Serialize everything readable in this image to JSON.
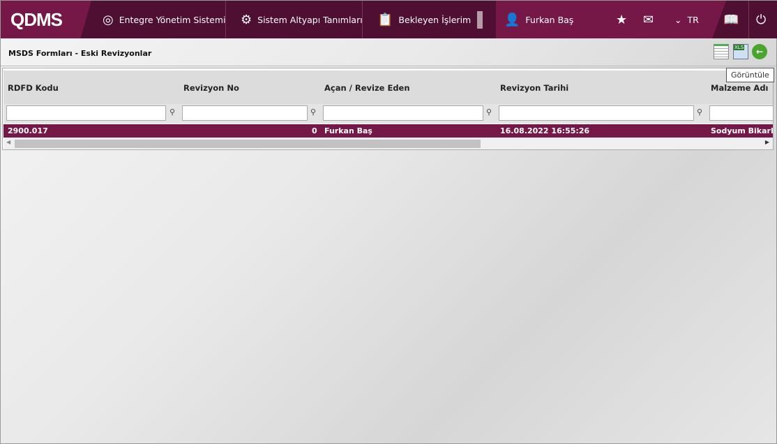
{
  "header": {
    "logo": "QDMS",
    "nav": [
      "Entegre Yönetim Sistemi",
      "Sistem Altyapı Tanımları",
      "Bekleyen İşlerim"
    ],
    "user": "Furkan Baş",
    "language": "TR"
  },
  "page": {
    "title": "MSDS Formları - Eski Revizyonlar",
    "tooltip": "Görüntüle"
  },
  "grid": {
    "columns": [
      "RDFD Kodu",
      "Revizyon No",
      "Açan / Revize Eden",
      "Revizyon Tarihi",
      "Malzeme Adı"
    ],
    "rows": [
      [
        "2900.017",
        "0",
        "Furkan Baş",
        "16.08.2022 16:55:26",
        "Sodyum Bikarbonat"
      ]
    ]
  },
  "colors": {
    "brand": "#751848",
    "brand_dark": "#4e0f32"
  }
}
